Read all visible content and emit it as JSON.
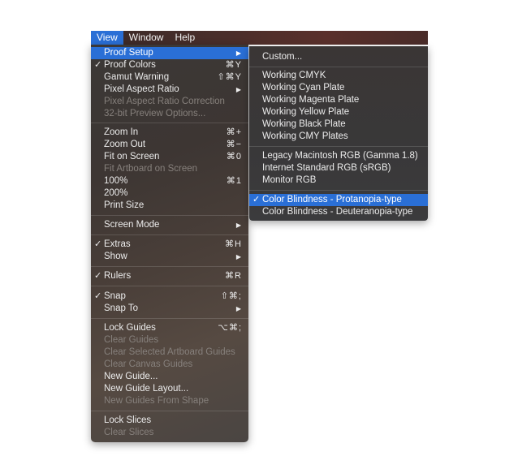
{
  "menubar": {
    "items": [
      {
        "label": "View",
        "active": true
      },
      {
        "label": "Window"
      },
      {
        "label": "Help"
      }
    ]
  },
  "view_menu": {
    "items": [
      {
        "label": "Proof Setup",
        "submenu": true,
        "highlight": true
      },
      {
        "label": "Proof Colors",
        "checked": true,
        "shortcut": "⌘Y"
      },
      {
        "label": "Gamut Warning",
        "shortcut": "⇧⌘Y"
      },
      {
        "label": "Pixel Aspect Ratio",
        "submenu": true
      },
      {
        "label": "Pixel Aspect Ratio Correction",
        "disabled": true
      },
      {
        "label": "32-bit Preview Options...",
        "disabled": true
      },
      {
        "label": "Zoom In",
        "shortcut": "⌘+"
      },
      {
        "label": "Zoom Out",
        "shortcut": "⌘−"
      },
      {
        "label": "Fit on Screen",
        "shortcut": "⌘0"
      },
      {
        "label": "Fit Artboard on Screen",
        "disabled": true
      },
      {
        "label": "100%",
        "shortcut": "⌘1"
      },
      {
        "label": "200%"
      },
      {
        "label": "Print Size"
      },
      {
        "label": "Screen Mode",
        "submenu": true
      },
      {
        "label": "Extras",
        "checked": true,
        "shortcut": "⌘H"
      },
      {
        "label": "Show",
        "submenu": true
      },
      {
        "label": "Rulers",
        "checked": true,
        "shortcut": "⌘R"
      },
      {
        "label": "Snap",
        "checked": true,
        "shortcut": "⇧⌘;"
      },
      {
        "label": "Snap To",
        "submenu": true
      },
      {
        "label": "Lock Guides",
        "shortcut": "⌥⌘;"
      },
      {
        "label": "Clear Guides",
        "disabled": true
      },
      {
        "label": "Clear Selected Artboard Guides",
        "disabled": true
      },
      {
        "label": "Clear Canvas Guides",
        "disabled": true
      },
      {
        "label": "New Guide..."
      },
      {
        "label": "New Guide Layout..."
      },
      {
        "label": "New Guides From Shape",
        "disabled": true
      },
      {
        "label": "Lock Slices"
      },
      {
        "label": "Clear Slices",
        "disabled": true
      }
    ]
  },
  "proof_setup_submenu": {
    "items": [
      {
        "label": "Custom..."
      },
      {
        "label": "Working CMYK"
      },
      {
        "label": "Working Cyan Plate"
      },
      {
        "label": "Working Magenta Plate"
      },
      {
        "label": "Working Yellow Plate"
      },
      {
        "label": "Working Black Plate"
      },
      {
        "label": "Working CMY Plates"
      },
      {
        "label": "Legacy Macintosh RGB (Gamma 1.8)"
      },
      {
        "label": "Internet Standard RGB (sRGB)"
      },
      {
        "label": "Monitor RGB"
      },
      {
        "label": "Color Blindness - Protanopia-type",
        "checked": true,
        "highlight": true
      },
      {
        "label": "Color Blindness - Deuteranopia-type"
      }
    ]
  },
  "icons": {
    "checkmark": "✓",
    "submenu_arrow": "▶"
  },
  "colors": {
    "highlight": "#2a6fd6",
    "menu_text": "#ececec",
    "disabled_text": "#86807c"
  }
}
